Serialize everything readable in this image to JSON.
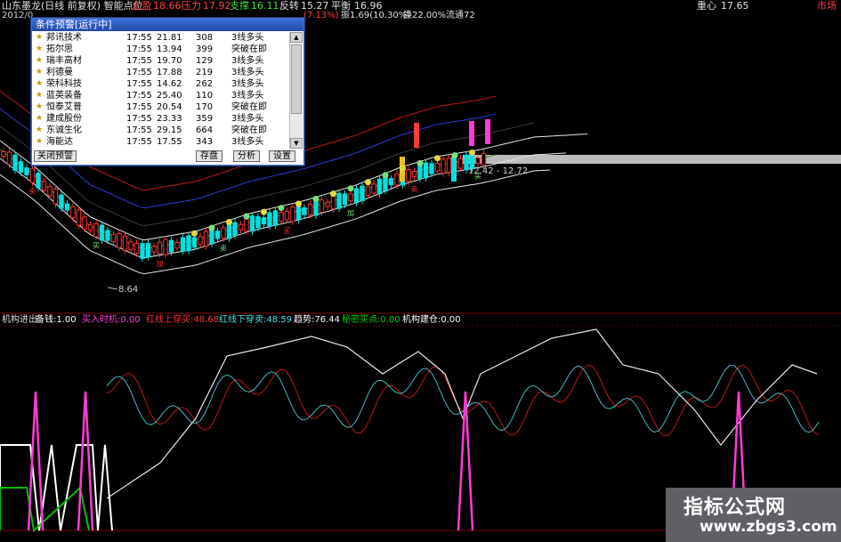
{
  "topbar": {
    "title": "山东墨龙(日线 前复权) 智能点位",
    "date": "2012/0",
    "zhiying_label": "止盈",
    "zhiying_value": "18.66",
    "yali_label": "压力",
    "yali_value": "17.92",
    "zhicheng_label": "支撑",
    "zhicheng_value": "16.11",
    "fanzhuan_label": "反转",
    "fanzhuan_value": "15.27",
    "pingheng_label": "平衡",
    "pingheng_value": "16.96",
    "change_pct": "(7.13%)",
    "amplitude": "振1.69(10.30%)",
    "turnover": "换22.00%",
    "float": "流通72",
    "center_label": "重心",
    "center_value": "17.65",
    "extra": "市场"
  },
  "alert": {
    "title": "条件预警[运行中]",
    "rows": [
      {
        "name": "邦讯技术",
        "time": "17:55",
        "price": "21.81",
        "vol": "308",
        "signal": "3线多头"
      },
      {
        "name": "拓尔思",
        "time": "17:55",
        "price": "13.94",
        "vol": "399",
        "signal": "突破在即"
      },
      {
        "name": "瑞丰高材",
        "time": "17:55",
        "price": "19.70",
        "vol": "129",
        "signal": "3线多头"
      },
      {
        "name": "利德曼",
        "time": "17:55",
        "price": "17.88",
        "vol": "219",
        "signal": "3线多头"
      },
      {
        "name": "荣科科技",
        "time": "17:55",
        "price": "14.62",
        "vol": "262",
        "signal": "3线多头"
      },
      {
        "name": "蓝英装备",
        "time": "17:55",
        "price": "25.40",
        "vol": "110",
        "signal": "3线多头"
      },
      {
        "name": "恒泰艾普",
        "time": "17:55",
        "price": "20.54",
        "vol": "170",
        "signal": "突破在即"
      },
      {
        "name": "建成股份",
        "time": "17:55",
        "price": "23.33",
        "vol": "359",
        "signal": "3线多头"
      },
      {
        "name": "东诚生化",
        "time": "17:55",
        "price": "29.15",
        "vol": "664",
        "signal": "突破在即"
      },
      {
        "name": "海能达",
        "time": "17:55",
        "price": "17.55",
        "vol": "343",
        "signal": "3线多头"
      }
    ],
    "buttons": {
      "close": "关闭预警",
      "save": "存盘",
      "analyze": "分析",
      "settings": "设置"
    }
  },
  "price_chart": {
    "low_label": "8.64",
    "range_label": "12.42 - 12.72",
    "markers": [
      "加",
      "买",
      "卖"
    ],
    "colors": {
      "up": "#ff3030",
      "down": "#00e0e0",
      "ma_white": "#e8e8e8",
      "ma_red": "#c01818",
      "ma_blue": "#2a3ed8",
      "ma_dark": "#3a3a3a"
    }
  },
  "indicator": {
    "name": "机构进出",
    "fields": [
      {
        "label": "备钱:",
        "value": "1.00",
        "color": "#ffffff"
      },
      {
        "label": "买入时机:",
        "value": "0.00",
        "color": "#ff3bd6"
      },
      {
        "label": "红线上穿买:",
        "value": "48.68",
        "color": "#ff3030"
      },
      {
        "label": "红线下穿卖:",
        "value": "48.59",
        "color": "#46e0e0"
      },
      {
        "label": "趋势:",
        "value": "76.44",
        "color": "#ffffff"
      },
      {
        "label": "秘密买点:",
        "value": "0.00",
        "color": "#00d000"
      },
      {
        "label": "机构建仓:",
        "value": "0.00",
        "color": "#ffffff"
      }
    ]
  },
  "watermark": {
    "line1": "指标公式网",
    "line2": "www.zbgs3.com"
  }
}
